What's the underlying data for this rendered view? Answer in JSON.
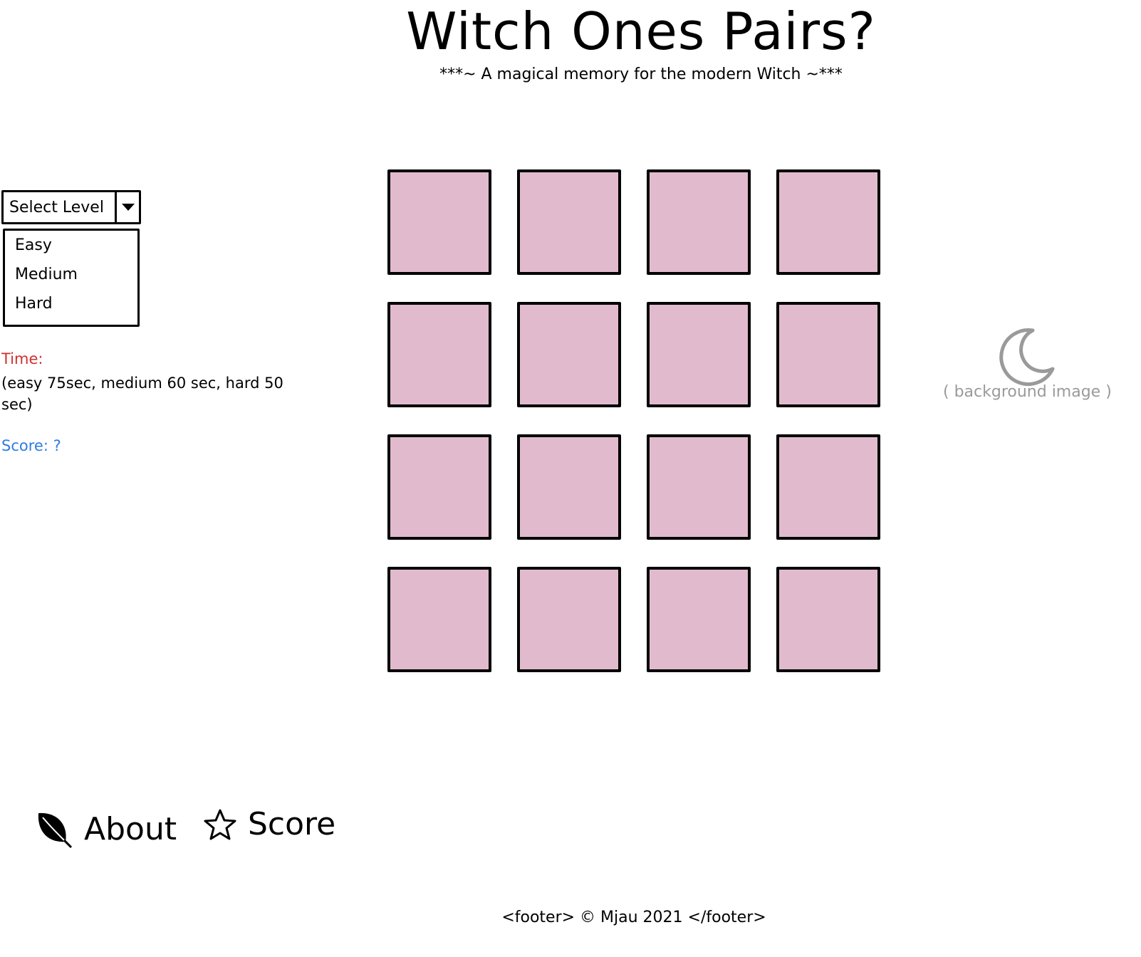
{
  "header": {
    "title": "Witch Ones Pairs?",
    "subtitle": "***~ A magical memory for the modern Witch ~***"
  },
  "level_select": {
    "label": "Select Level",
    "options": [
      "Easy",
      "Medium",
      "Hard"
    ]
  },
  "stats": {
    "time_label": "Time:",
    "time_description": "(easy 75sec, medium 60 sec, hard 50 sec)",
    "score_label": "Score: ?"
  },
  "board": {
    "rows": 4,
    "columns": 4,
    "card_color": "#e1bbcd"
  },
  "background": {
    "icon": "moon-icon",
    "label": "( background image )"
  },
  "nav": {
    "about": {
      "icon": "leaf-icon",
      "label": "About"
    },
    "score": {
      "icon": "star-icon",
      "label": "Score"
    }
  },
  "footer": {
    "text": "<footer>  © Mjau 2021 </footer>"
  },
  "colors": {
    "time": "#d32f2f",
    "score": "#2f7ae0",
    "placeholder": "#9a9a9a"
  }
}
